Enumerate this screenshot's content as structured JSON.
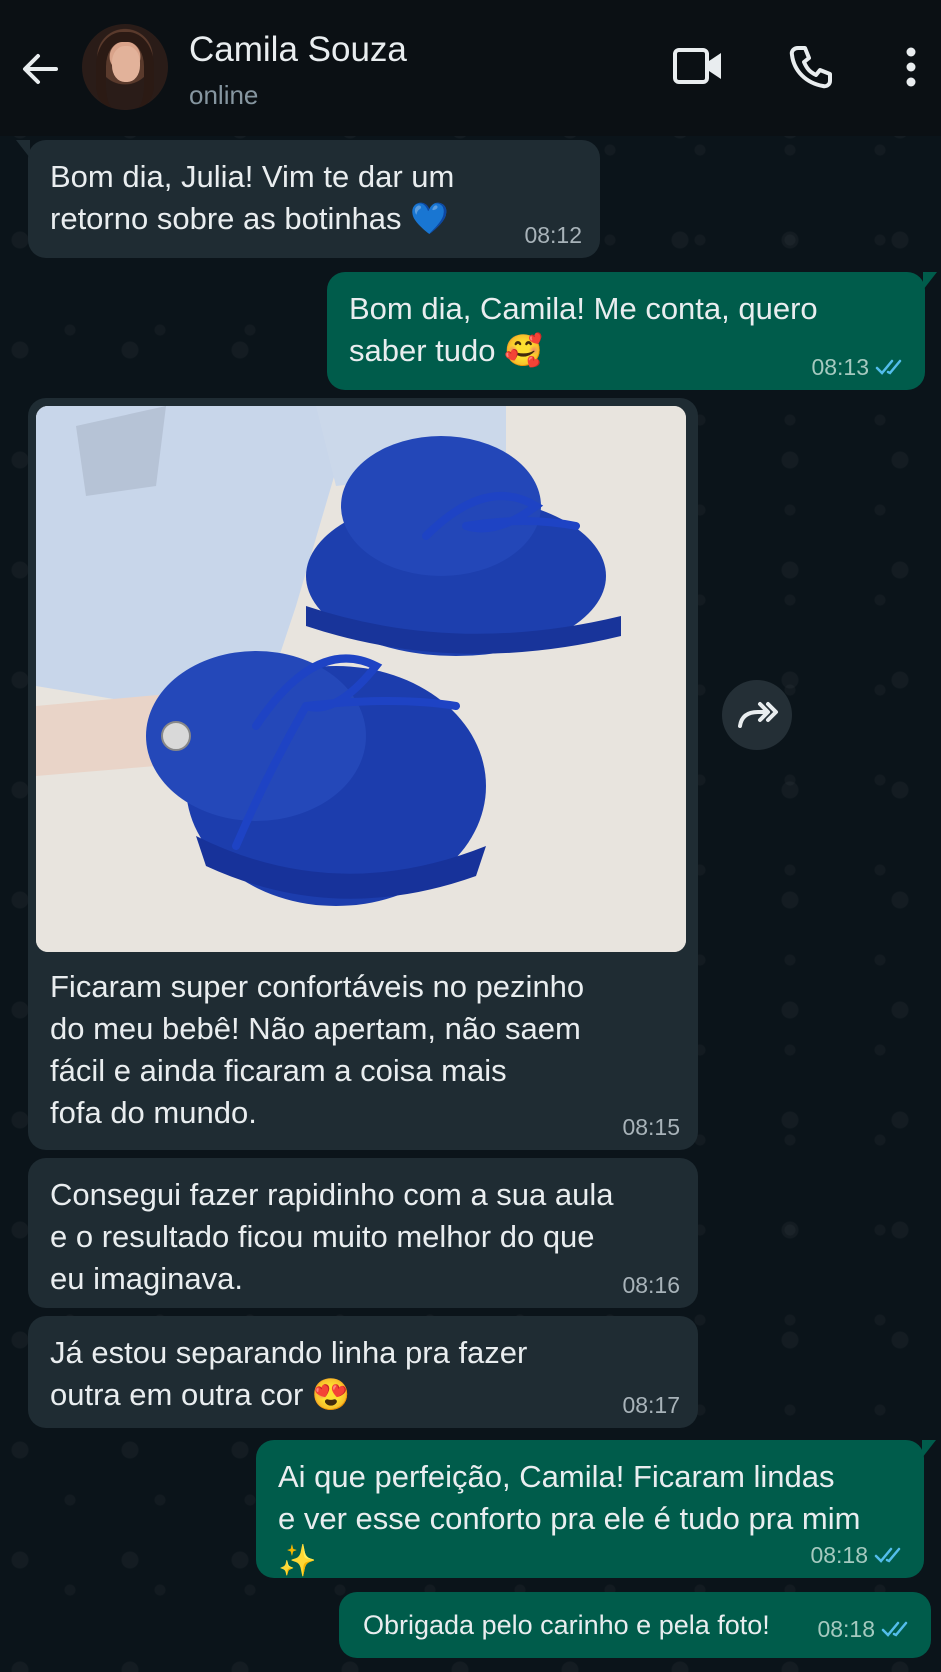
{
  "header": {
    "contact_name": "Camila Souza",
    "status": "online",
    "icons": [
      "back-arrow-icon",
      "video-call-icon",
      "phone-icon",
      "more-vert-icon"
    ]
  },
  "messages": [
    {
      "direction": "in",
      "text": "Bom dia, Julia! Vim te dar um\nretorno sobre as botinhas 💙",
      "time": "08:12"
    },
    {
      "direction": "out",
      "text": "Bom dia, Camila! Me conta, quero\nsaber tudo 🥰",
      "time": "08:13",
      "read": true
    },
    {
      "direction": "in",
      "type": "image",
      "image_alt": "blue crochet baby booties",
      "caption": "Ficaram super confortáveis no pezinho\ndo meu bebê! Não apertam, não saem\nfácil e ainda ficaram a coisa mais\nfofa do mundo.",
      "time": "08:15"
    },
    {
      "direction": "in",
      "text": "Consegui fazer rapidinho com a sua aula\ne o resultado ficou muito melhor do que\neu imaginava.",
      "time": "08:16"
    },
    {
      "direction": "in",
      "text": "Já estou separando linha pra fazer\noutra em outra cor 😍",
      "time": "08:17"
    },
    {
      "direction": "out",
      "text": "Ai que perfeição, Camila! Ficaram lindas\ne ver esse conforto pra ele é tudo pra mim ✨",
      "time": "08:18",
      "read": true
    },
    {
      "direction": "out",
      "text": "Obrigada pelo carinho e pela foto!",
      "time": "08:18",
      "read": true
    }
  ],
  "colors": {
    "background": "#0b141a",
    "incoming_bubble": "#1f2c33",
    "outgoing_bubble": "#005c4b",
    "read_ticks": "#53bdeb"
  }
}
